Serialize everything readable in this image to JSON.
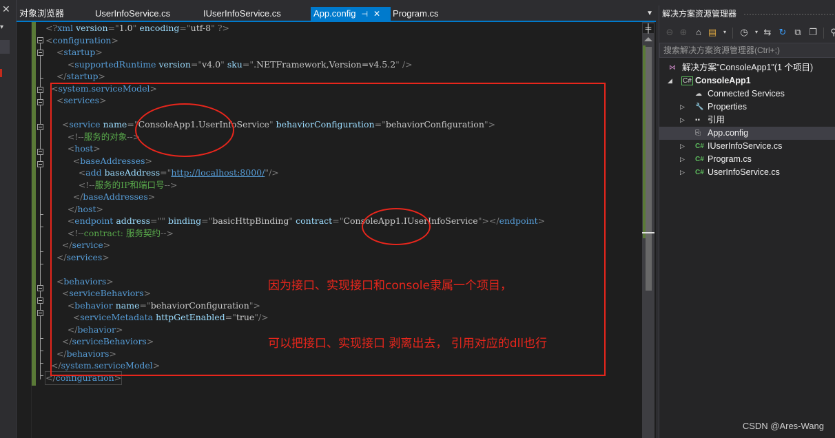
{
  "tabs": [
    {
      "label": "对象浏览器",
      "active": false
    },
    {
      "label": "UserInfoService.cs",
      "active": false
    },
    {
      "label": "IUserInfoService.cs",
      "active": false
    },
    {
      "label": "App.config",
      "active": true
    },
    {
      "label": "Program.cs",
      "active": false
    }
  ],
  "tab_icons": {
    "pin": "⊣",
    "close": "✕",
    "overflow": "▼"
  },
  "code_lines": [
    "<?xml version=\"1.0\" encoding=\"utf-8\" ?>",
    "<configuration>",
    "    <startup>",
    "        <supportedRuntime version=\"v4.0\" sku=\".NETFramework,Version=v4.5.2\" />",
    "    </startup>",
    "  <system.serviceModel>",
    "    <services>",
    "",
    "      <service name=\"ConsoleApp1.UserInfoService\" behaviorConfiguration=\"behaviorConfiguration\">",
    "        <!--服务的对象-->",
    "        <host>",
    "          <baseAddresses>",
    "            <add baseAddress=\"http://localhost:8000/\"/>",
    "            <!--服务的IP和端口号-->",
    "          </baseAddresses>",
    "        </host>",
    "        <endpoint address=\"\" binding=\"basicHttpBinding\" contract=\"ConsoleApp1.IUserInfoService\"></endpoint>",
    "        <!--contract: 服务契约-->",
    "      </service>",
    "    </services>",
    "",
    "    <behaviors>",
    "      <serviceBehaviors>",
    "        <behavior name=\"behaviorConfiguration\">",
    "          <serviceMetadata httpGetEnabled=\"true\"/>",
    "        </behavior>",
    "      </serviceBehaviors>",
    "    </behaviors>",
    "  </system.serviceModel>",
    "</configuration>"
  ],
  "annotations": {
    "note1": "因为接口、实现接口和console隶属一个项目，",
    "note2": "可以把接口、实现接口  剥离出去， 引用对应的dll也行",
    "highlight_color": "#e8261c"
  },
  "solution_explorer": {
    "title": "解决方案资源管理器",
    "search_placeholder": "搜索解决方案资源管理器(Ctrl+;)",
    "toolbar_icons": [
      "back-icon",
      "forward-icon",
      "home-icon",
      "switch-views-icon",
      "dropdown-icon",
      "pending-changes-icon",
      "dropdown-icon",
      "sync-icon",
      "refresh-icon",
      "collapse-all-icon",
      "show-all-files-icon",
      "properties-icon"
    ],
    "solution_label": "解决方案\"ConsoleApp1\"(1 个项目)",
    "project_label": "ConsoleApp1",
    "items": [
      {
        "label": "Connected Services",
        "icon": "connected-services-icon",
        "expandable": false
      },
      {
        "label": "Properties",
        "icon": "wrench-icon",
        "expandable": true
      },
      {
        "label": "引用",
        "icon": "references-icon",
        "expandable": true
      },
      {
        "label": "App.config",
        "icon": "config-file-icon",
        "expandable": false,
        "selected": true
      },
      {
        "label": "IUserInfoService.cs",
        "icon": "csharp-file-icon",
        "expandable": true
      },
      {
        "label": "Program.cs",
        "icon": "csharp-file-icon",
        "expandable": true
      },
      {
        "label": "UserInfoService.cs",
        "icon": "csharp-file-icon",
        "expandable": true
      }
    ]
  },
  "watermark": "CSDN @Ares-Wang"
}
